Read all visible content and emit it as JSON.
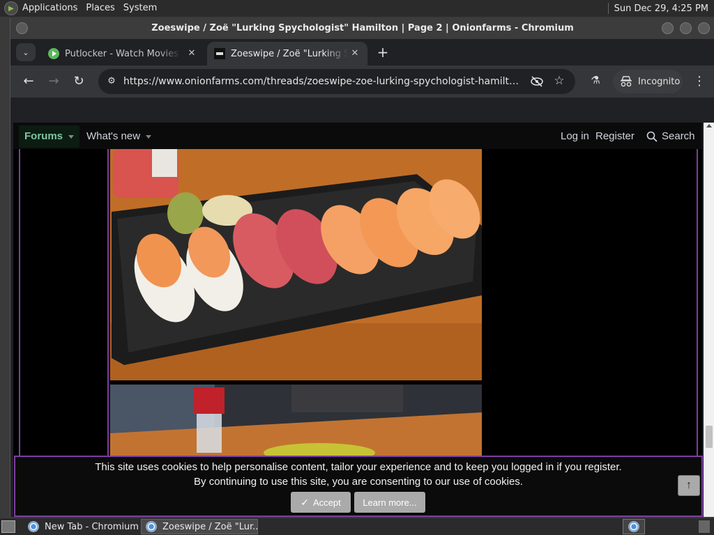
{
  "top_panel": {
    "menus": [
      "Applications",
      "Places",
      "System"
    ],
    "clock": "Sun Dec 29,  4:25 PM"
  },
  "window": {
    "title": "Zoeswipe / Zoë \"Lurking Spychologist\" Hamilton | Page 2 | Onionfarms - Chromium"
  },
  "tabs": [
    {
      "title": "Putlocker - Watch Movies & Series"
    },
    {
      "title": "Zoeswipe / Zoë \"Lurking Spychologist\" Hamilton"
    }
  ],
  "toolbar": {
    "url": "https://www.onionfarms.com/threads/zoeswipe-zoe-lurking-spychologist-hamilton.3216/...",
    "incognito_label": "Incognito"
  },
  "site_nav": {
    "forums": "Forums",
    "whats_new": "What's new",
    "login": "Log in",
    "register": "Register",
    "search": "Search"
  },
  "cookie_notice": {
    "line1": "This site uses cookies to help personalise content, tailor your experience and to keep you logged in if you register.",
    "line2": "By continuing to use this site, you are consenting to our use of cookies.",
    "accept": "Accept",
    "learn_more": "Learn more..."
  },
  "taskbar": {
    "items": [
      "New Tab - Chromium",
      "Zoeswipe / Zoë \"Lur..."
    ]
  },
  "colors": {
    "accent_purple": "#7b3fa0",
    "forums_green": "#7fc6a0"
  }
}
